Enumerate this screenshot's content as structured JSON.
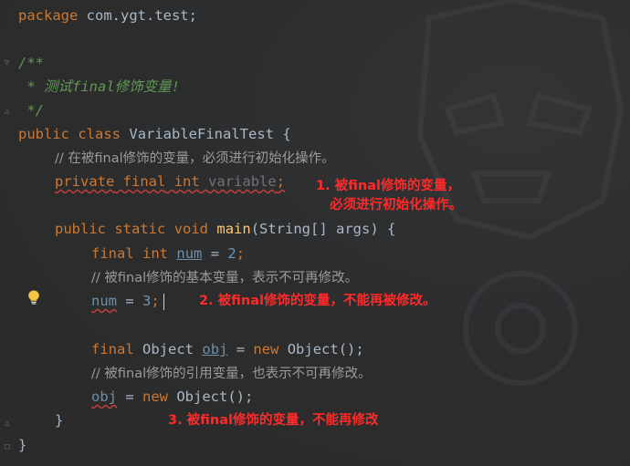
{
  "code": {
    "l1": {
      "kw": "package",
      "rest": " com.ygt.test;"
    },
    "l3": "/**",
    "l4": " * 测试final修饰变量!",
    "l5": " */",
    "l6": {
      "kw1": "public",
      "kw2": "class",
      "name": "VariableFinalTest",
      "brace": " {"
    },
    "l7": "// 在被final修饰的变量，必须进行初始化操作。",
    "l8": {
      "kw1": "private",
      "kw2": "final",
      "kw3": "int",
      "name": "variable",
      "semi": ";"
    },
    "l10": {
      "kw1": "public",
      "kw2": "static",
      "kw3": "void",
      "fn": "main",
      "params": "(String[] args) {"
    },
    "l11": {
      "kw1": "final",
      "kw2": "int",
      "var": "num",
      "assign": " = ",
      "val": "2",
      "semi": ";"
    },
    "l12": "// 被final修饰的基本变量，表示不可再修改。",
    "l13": {
      "var": "num",
      "assign": " = ",
      "val": "3",
      "semi": ";"
    },
    "l15": {
      "kw1": "final",
      "type": "Object",
      "var": "obj",
      "assign": " = ",
      "kw2": "new",
      "ctor": "Object();"
    },
    "l16": "// 被final修饰的引用变量，也表示不可再修改。",
    "l17": {
      "var": "obj",
      "assign": " = ",
      "kw": "new",
      "ctor": "Object();"
    },
    "l18": "}",
    "l19": "}"
  },
  "annotations": {
    "a1": "1. 被final修饰的变量，\n   必须进行初始化操作。",
    "a2": "2. 被final修饰的变量，不能再被修改。",
    "a3": "3. 被final修饰的变量，不能再修改"
  },
  "colors": {
    "background": "#2b2b2b",
    "keyword": "#cc7832",
    "annotation": "#ff2a2a",
    "doc_comment": "#629755"
  },
  "icons": [
    "fold-icon",
    "lightbulb-icon",
    "text-caret"
  ]
}
